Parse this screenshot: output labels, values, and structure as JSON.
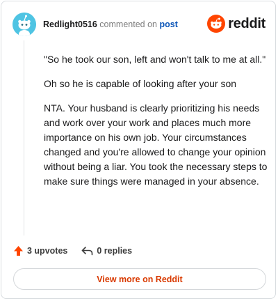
{
  "header": {
    "username": "Redlight0516",
    "action_text": "commented on",
    "post_link": "post"
  },
  "brand": {
    "wordmark": "reddit",
    "icon": "reddit-logo-icon",
    "color": "#ff4500"
  },
  "comment": {
    "paragraphs": [
      "\"So he took our son, left and won't talk to me at all.\"",
      "Oh so he is capable of looking after your son",
      "NTA. Your husband is clearly prioritizing his needs and work over your work and places much more importance on his own job. Your circumstances changed and you're allowed to change your opinion without being a liar. You took the necessary steps to make sure things were managed in your absence."
    ]
  },
  "actions": {
    "upvotes": "3 upvotes",
    "replies": "0 replies",
    "upvote_icon": "upvote-arrow-icon",
    "reply_icon": "reply-arrow-icon",
    "upvote_color": "#ff4500"
  },
  "footer": {
    "view_more": "View more on Reddit"
  },
  "avatar": {
    "icon": "snoo-avatar-icon",
    "color": "#4fc4e3"
  }
}
